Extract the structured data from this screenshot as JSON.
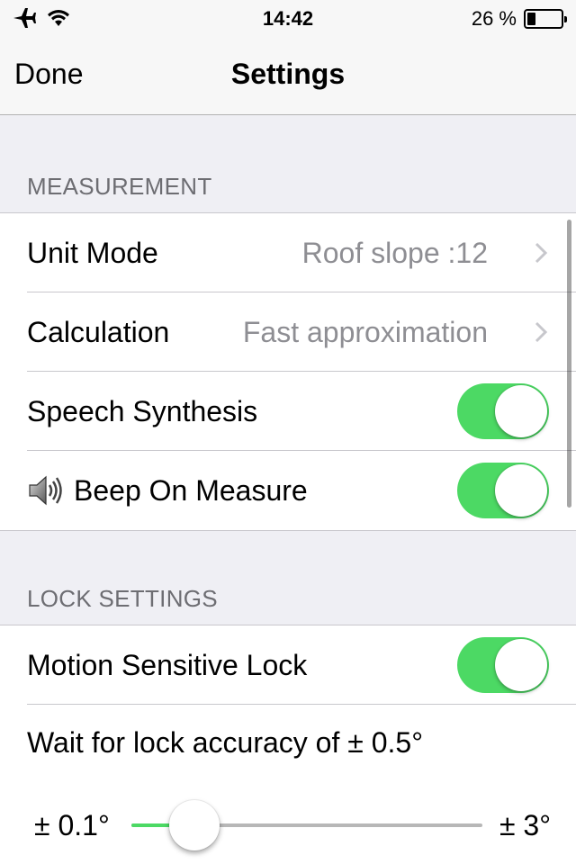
{
  "status_bar": {
    "time": "14:42",
    "battery_percent": "26 %",
    "battery_level": 0.26,
    "icons": [
      "airplane-icon",
      "wifi-icon",
      "battery-icon"
    ]
  },
  "nav": {
    "done_label": "Done",
    "title": "Settings"
  },
  "sections": {
    "measurement": {
      "header": "MEASUREMENT",
      "unit_mode": {
        "label": "Unit Mode",
        "value": "Roof slope :12"
      },
      "calculation": {
        "label": "Calculation",
        "value": "Fast approximation"
      },
      "speech_synthesis": {
        "label": "Speech Synthesis",
        "on": true
      },
      "beep_on_measure": {
        "label": "Beep On Measure",
        "icon": "speaker-icon",
        "on": true
      }
    },
    "lock": {
      "header": "LOCK SETTINGS",
      "motion_sensitive_lock": {
        "label": "Motion Sensitive Lock",
        "on": true
      },
      "accuracy": {
        "label": "Wait for lock accuracy of ± 0.5°",
        "min_label": "± 0.1°",
        "max_label": "± 3°",
        "slider_fraction": 0.2
      }
    }
  },
  "colors": {
    "switch_on": "#4cd964",
    "background": "#efeff4",
    "secondary_text": "#8e8e93"
  }
}
